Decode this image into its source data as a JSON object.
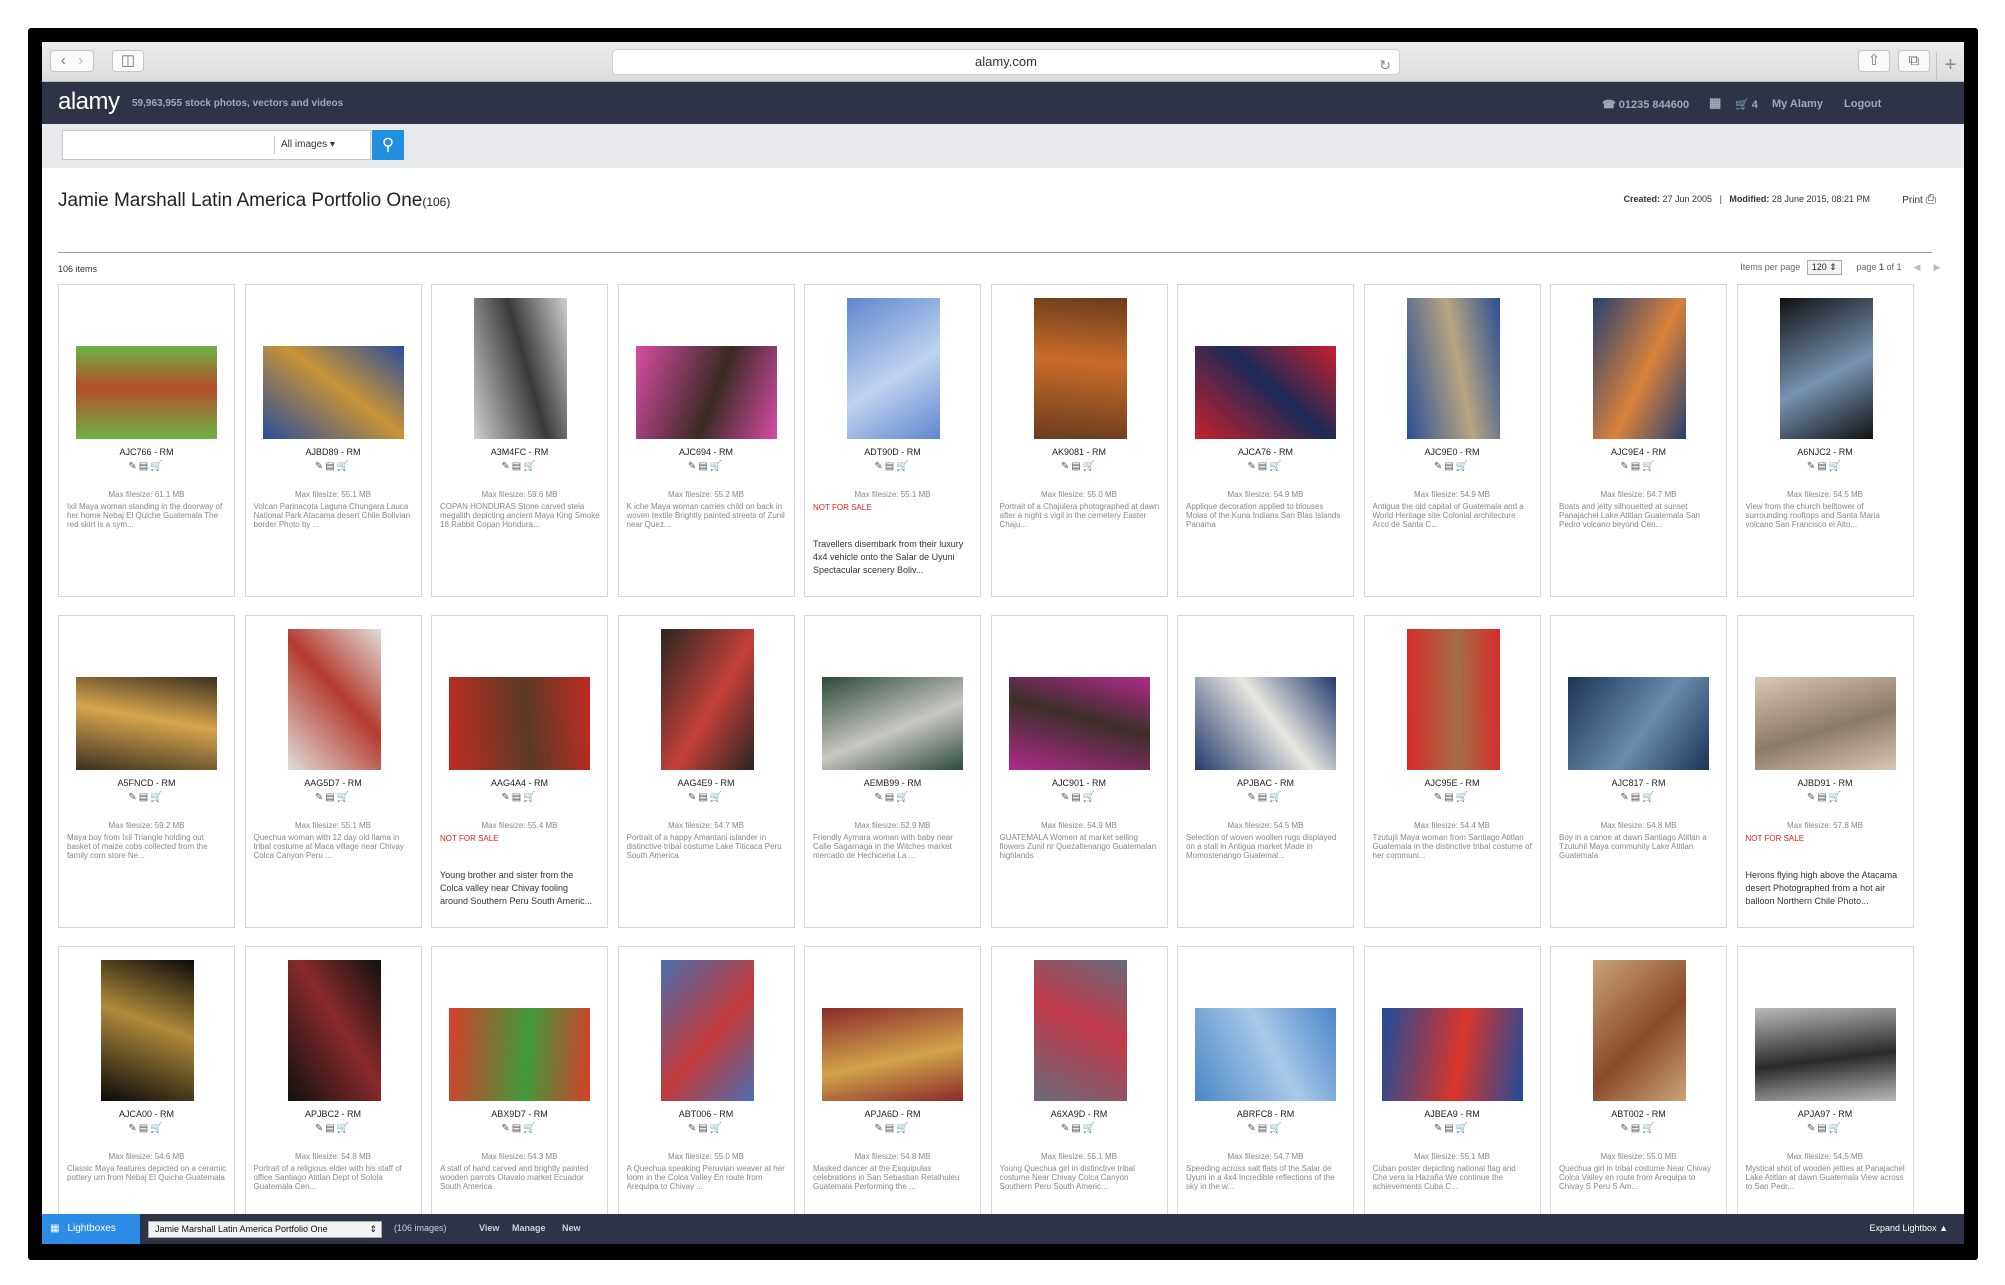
{
  "browser": {
    "url": "alamy.com",
    "back_icon": "chevron-left-icon",
    "forward_icon": "chevron-right-icon"
  },
  "header": {
    "logo": "alamy",
    "tagline": "59,963,955 stock photos, vectors and videos",
    "phone": "01235 844600",
    "cart_count": "4",
    "my_alamy": "My Alamy",
    "logout": "Logout"
  },
  "search": {
    "placeholder": "",
    "category": "All images"
  },
  "page": {
    "title": "Jamie Marshall Latin America Portfolio One",
    "count": "(106)",
    "created_label": "Created:",
    "created": "27 Jun 2005",
    "modified_label": "Modified:",
    "modified": "28 June 2015, 08:21 PM",
    "print": "Print",
    "items_count": "106 items",
    "items_per_page_label": "Items per page",
    "items_per_page": "120",
    "page_label": "page",
    "page_num": "1",
    "page_of": "of",
    "page_total": "1"
  },
  "colors": {
    "header": "#2e3346",
    "accent": "#2190e0",
    "not_for_sale": "#e0241c"
  },
  "cards": [
    {
      "code": "AJC766 - RM",
      "size": "Max filesize: 61.1 MB",
      "desc": "Ixil Maya woman standing in the doorway of her home Nebaj El Quiche Guatemala The red skirt is a sym...",
      "nfs": "",
      "c1": "#6bb443",
      "c2": "#b74c2b",
      "orient": "land"
    },
    {
      "code": "AJBD89 - RM",
      "size": "Max filesize: 55.1 MB",
      "desc": "Volcan Parinacota Laguna Chungara Lauca National Park Atacama desert Chile Bolivian border Photo by ...",
      "nfs": "",
      "c1": "#2a4d9a",
      "c2": "#c89436",
      "orient": "land"
    },
    {
      "code": "A3M4FC - RM",
      "size": "Max filesize: 59.6 MB",
      "desc": "COPAN HONDURAS Stone carved stela megalith depicting ancient Maya King Smoke 18 Rabbit Copan Hondura...",
      "nfs": "",
      "c1": "#cfcfcf",
      "c2": "#3a3a3a",
      "orient": "port"
    },
    {
      "code": "AJC694 - RM",
      "size": "Max filesize: 55.2 MB",
      "desc": "K iche Maya woman carries child on back in woven textile Brightly painted streets of Zunil near Quez...",
      "nfs": "",
      "c1": "#d84ca4",
      "c2": "#3b2a24",
      "orient": "land"
    },
    {
      "code": "ADT90D - RM",
      "size": "Max filesize: 55.1 MB",
      "desc": "",
      "nfs": "NOT FOR SALE",
      "nfsdesc": "Travellers disembark from their luxury 4x4 vehicle onto the Salar de Uyuni Spectacular scenery Boliv...",
      "c1": "#5f86cf",
      "c2": "#bfd3ef",
      "orient": "port"
    },
    {
      "code": "AK9081 - RM",
      "size": "Max filesize: 55.0 MB",
      "desc": "Portrait of a Chajulera photographed at dawn after a night s vigil in the cemetery Easter Chaju...",
      "nfs": "",
      "c1": "#6a3c1d",
      "c2": "#c96c2a",
      "orient": "port"
    },
    {
      "code": "AJCA76 - RM",
      "size": "Max filesize: 54.9 MB",
      "desc": "Applique decoration applied to blouses Molas of the Kuna Indians San Blas Islands Panama",
      "nfs": "",
      "c1": "#c8202c",
      "c2": "#1c2a58",
      "orient": "land"
    },
    {
      "code": "AJC9E0 - RM",
      "size": "Max filesize: 54.9 MB",
      "desc": "Antigua the old capital of Guatemala and a World Heritage site Colonial architecture Arco de Santa C...",
      "nfs": "",
      "c1": "#2a4f94",
      "c2": "#b8a581",
      "orient": "port"
    },
    {
      "code": "AJC9E4 - RM",
      "size": "Max filesize: 54.7 MB",
      "desc": "Boats and jetty silhouetted at sunset Panajachel Lake Atitlan Guatemala San Pedro volcano beyond Cen...",
      "nfs": "",
      "c1": "#28406e",
      "c2": "#d9823c",
      "orient": "port"
    },
    {
      "code": "A6NJC2 - RM",
      "size": "Max filesize: 54.5 MB",
      "desc": "View from the church belltower of surrounding rooftops and Santa Maria volcano San Francisco el Alto...",
      "nfs": "",
      "c1": "#111111",
      "c2": "#7793b2",
      "orient": "port"
    },
    {
      "code": "A5FNCD - RM",
      "size": "Max filesize: 59.2 MB",
      "desc": "Maya boy from Ixil Triangle holding out basket of maize cobs collected from the family corn store Ne...",
      "nfs": "",
      "c1": "#3c3023",
      "c2": "#d7a64c",
      "orient": "land"
    },
    {
      "code": "AAG5D7 - RM",
      "size": "Max filesize: 55.1 MB",
      "desc": "Quechua woman with 12 day old llama in tribal costume at Maca village near Chivay Colca Canyon Peru ...",
      "nfs": "",
      "c1": "#e0ddd8",
      "c2": "#b53a2e",
      "orient": "port"
    },
    {
      "code": "AAG4A4 - RM",
      "size": "Max filesize: 55.4 MB",
      "desc": "",
      "nfs": "NOT FOR SALE",
      "nfsdesc": "Young brother and sister from the Colca valley near Chivay fooling around Southern Peru South Americ...",
      "c1": "#c12a22",
      "c2": "#5b3b26",
      "orient": "land"
    },
    {
      "code": "AAG4E9 - RM",
      "size": "Max filesize: 54.7 MB",
      "desc": "Portrait of a happy Amantani islander in distinctive tribal costume Lake Titicaca Peru South America",
      "nfs": "",
      "c1": "#2a2622",
      "c2": "#c4403a",
      "orient": "port"
    },
    {
      "code": "AEMB99 - RM",
      "size": "Max filesize: 52.9 MB",
      "desc": "Friendly Aymara woman with baby near Calle Sagarnaga in the Witches market mercado de Hechiceria La ...",
      "nfs": "",
      "c1": "#2c4a3a",
      "c2": "#c9c7c2",
      "orient": "land"
    },
    {
      "code": "AJC901 - RM",
      "size": "Max filesize: 54.9 MB",
      "desc": "GUATEMALA Women at market selling flowers Zunil nr Quezaltenango Guatemalan highlands",
      "nfs": "",
      "c1": "#b02a8a",
      "c2": "#3c2f2a",
      "orient": "land"
    },
    {
      "code": "APJBAC - RM",
      "size": "Max filesize: 54.5 MB",
      "desc": "Selection of woven woollen rugs displayed on a stall in Antigua market Made in Momostenango Guatemal...",
      "nfs": "",
      "c1": "#223a6e",
      "c2": "#e8e6e0",
      "orient": "land"
    },
    {
      "code": "AJC95E - RM",
      "size": "Max filesize: 54.4 MB",
      "desc": "Tzutujil Maya woman from Santiago Atitlan Guatemala in the distinctive tribal costume of her communi...",
      "nfs": "",
      "c1": "#d72a2a",
      "c2": "#a46e48",
      "orient": "port"
    },
    {
      "code": "AJC817 - RM",
      "size": "Max filesize: 54.8 MB",
      "desc": "Boy in a canoe at dawn Santiago Atitlan a Tzutuhil Maya community Lake Atitlan Guatemala",
      "nfs": "",
      "c1": "#1b3454",
      "c2": "#6a8cad",
      "orient": "land"
    },
    {
      "code": "AJBD91 - RM",
      "size": "Max filesize: 57.8 MB",
      "desc": "",
      "nfs": "NOT FOR SALE",
      "nfsdesc": "Herons flying high above the Atacama desert Photographed from a hot air balloon Northern Chile Photo...",
      "c1": "#d7c7b3",
      "c2": "#8a7a68",
      "orient": "land"
    },
    {
      "code": "AJCA00 - RM",
      "size": "Max filesize: 54.6 MB",
      "desc": "Classic Maya features depicted on a ceramic pottery urn from Nebaj El Quiche Guatemala",
      "nfs": "",
      "c1": "#0a0a0a",
      "c2": "#b08a3a",
      "orient": "port"
    },
    {
      "code": "APJBC2 - RM",
      "size": "Max filesize: 54.8 MB",
      "desc": "Portrait of a religious elder with his staff of office Santiago Atitlan Dept of Solola Guatemala Cen...",
      "nfs": "",
      "c1": "#111111",
      "c2": "#8a2a2a",
      "orient": "port"
    },
    {
      "code": "ABX9D7 - RM",
      "size": "Max filesize: 54.3 MB",
      "desc": "A stall of hand carved and brightly painted wooden parrots Otavalo market Ecuador South America",
      "nfs": "",
      "c1": "#d63f2a",
      "c2": "#3e9a3a",
      "orient": "land"
    },
    {
      "code": "ABT006 - RM",
      "size": "Max filesize: 55.0 MB",
      "desc": "A Quechua speaking Peruvian weaver at her loom in the Colca Valley En route from Arequipa to Chivay ...",
      "nfs": "",
      "c1": "#4a6fb0",
      "c2": "#c23a3a",
      "orient": "port"
    },
    {
      "code": "APJA6D - RM",
      "size": "Max filesize: 54.8 MB",
      "desc": "Masked dancer at the Esquipulas celebrations in San Sebastian Retalhuleu Guatemala Performing the ...",
      "nfs": "",
      "c1": "#8a2a2a",
      "c2": "#d2a34a",
      "orient": "land"
    },
    {
      "code": "A6XA9D - RM",
      "size": "Max filesize: 55.1 MB",
      "desc": "Young Quechua girl in distinctive tribal costume Near Chivay Colca Canyon Southern Peru South Americ...",
      "nfs": "",
      "c1": "#6a6a7a",
      "c2": "#c23a4a",
      "orient": "port"
    },
    {
      "code": "ABRFC8 - RM",
      "size": "Max filesize: 54.7 MB",
      "desc": "Speeding across salt flats of the Salar de Uyuni in a 4x4 Incredible reflections of the sky in the w...",
      "nfs": "",
      "c1": "#4a86c9",
      "c2": "#a9c9e7",
      "orient": "land"
    },
    {
      "code": "AJBEA9 - RM",
      "size": "Max filesize: 55.1 MB",
      "desc": "Cuban poster depicting national flag and Che vera la Hazaña We continue the achievements Cuba C...",
      "nfs": "",
      "c1": "#1f4b9a",
      "c2": "#d9352a",
      "orient": "land"
    },
    {
      "code": "ABT002 - RM",
      "size": "Max filesize: 55.0 MB",
      "desc": "Quechua girl in tribal costume Near Chivay Colca Valley en route from Arequipa to Chivay S Peru S Am...",
      "nfs": "",
      "c1": "#c9a37a",
      "c2": "#8a4a2a",
      "orient": "port"
    },
    {
      "code": "APJA97 - RM",
      "size": "Max filesize: 54.5 MB",
      "desc": "Mystical shot of wooden jetties at Panajachel Lake Atitlan at dawn Guatemala View across to San Pedr...",
      "nfs": "",
      "c1": "#b9b9b9",
      "c2": "#2a2a2a",
      "orient": "land"
    }
  ],
  "bottom": {
    "lightboxes": "Lightboxes",
    "selected": "Jamie Marshall Latin America Portfolio One",
    "count": "(106 images)",
    "view": "View",
    "manage": "Manage",
    "new": "New",
    "expand": "Expand Lightbox"
  }
}
